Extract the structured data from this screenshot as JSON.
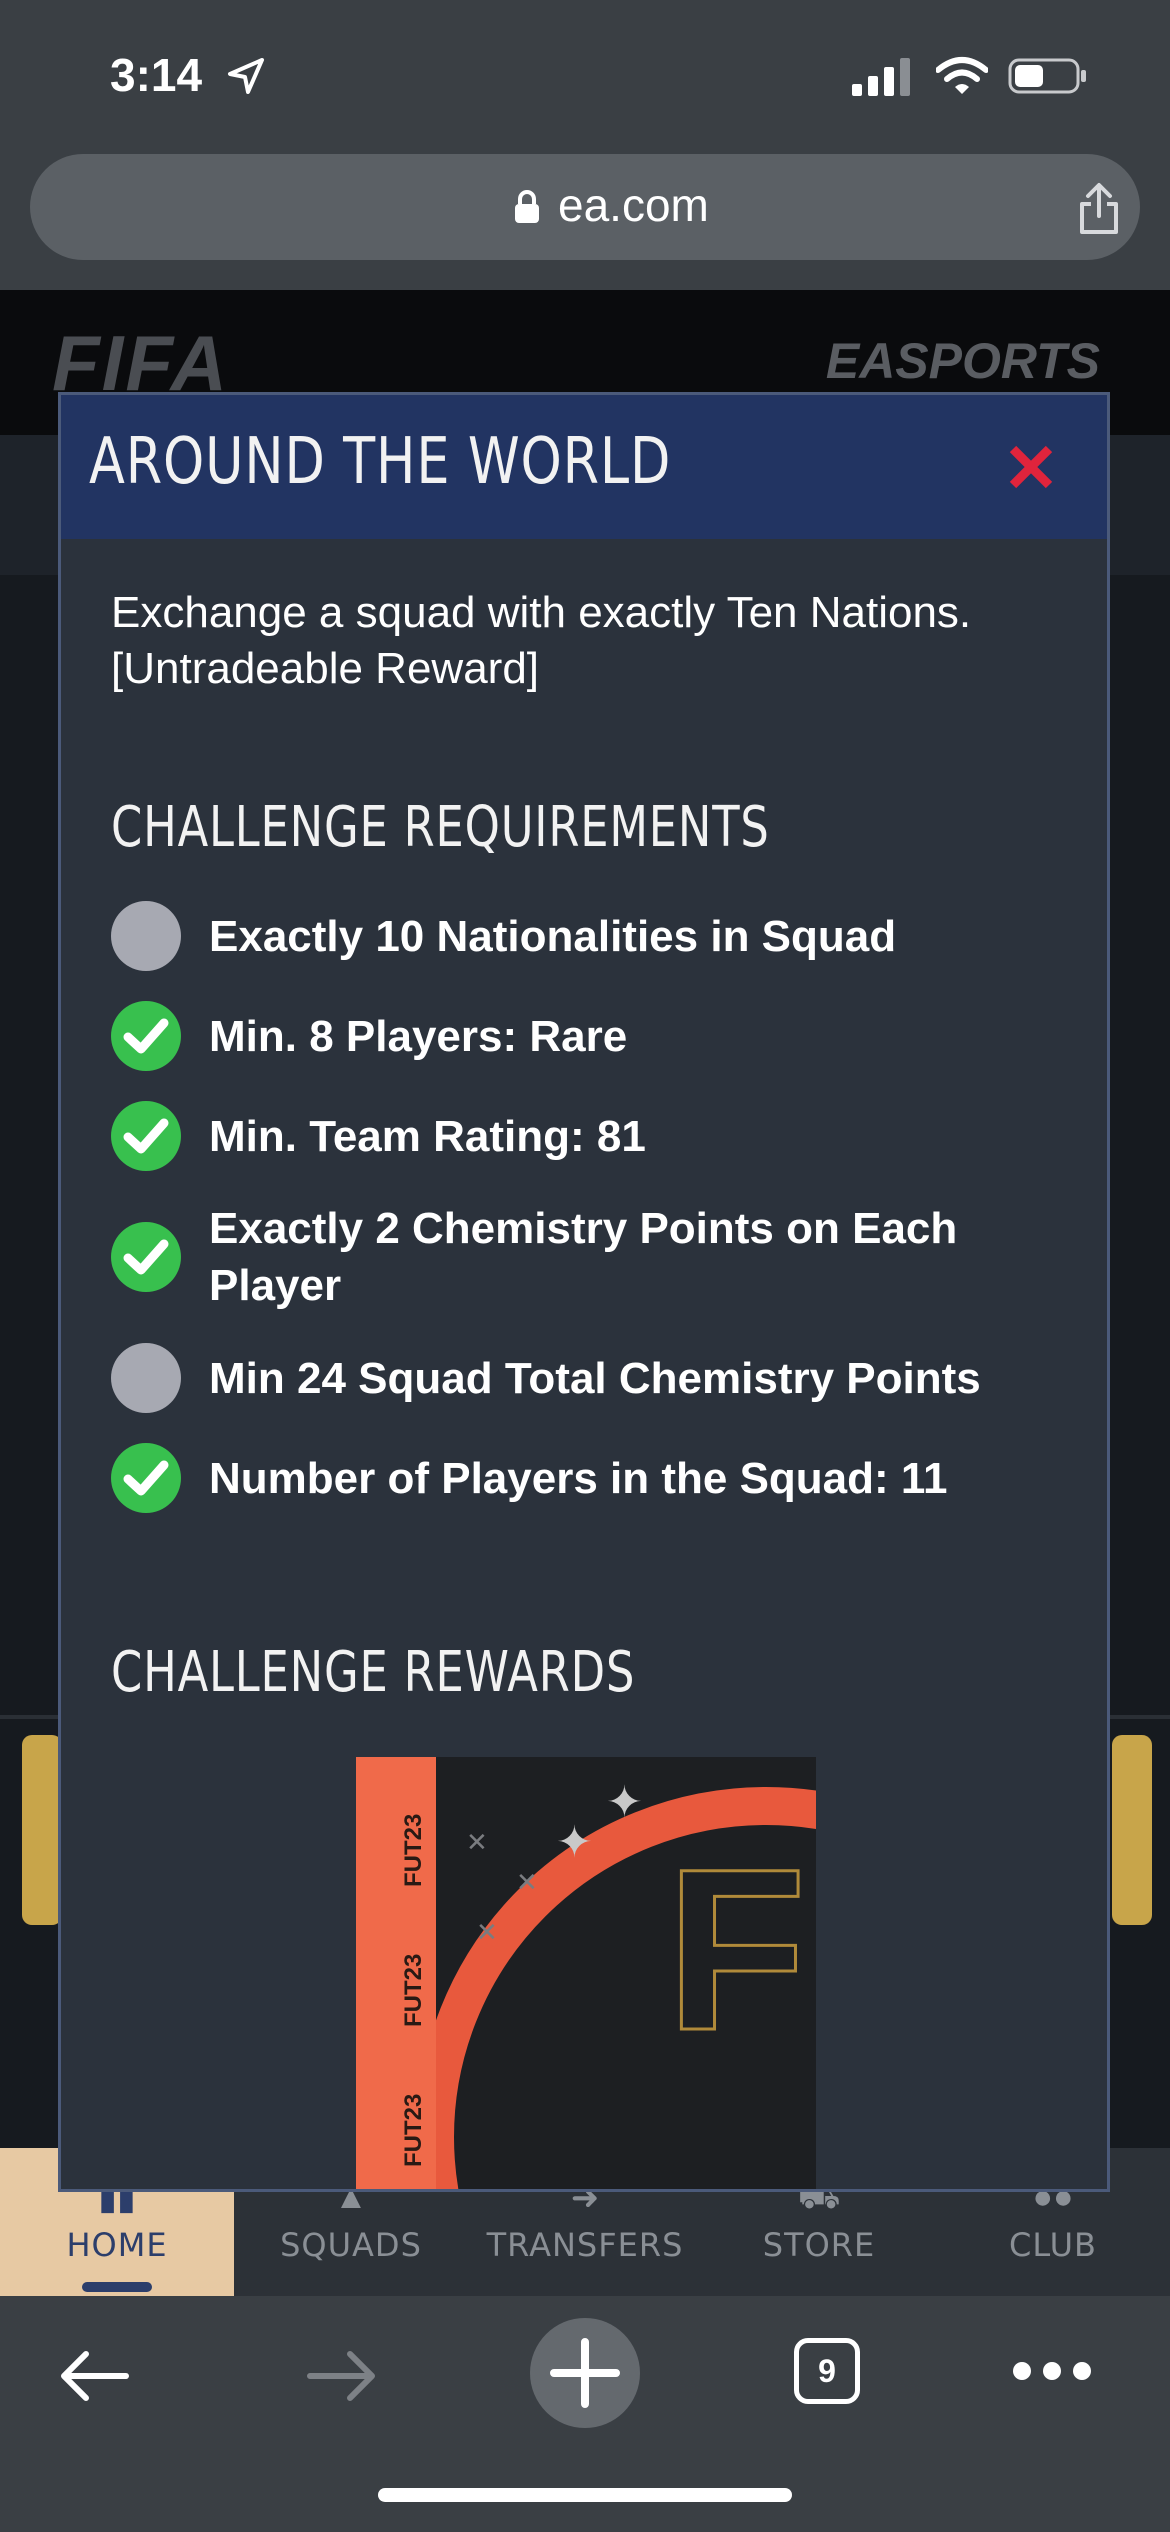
{
  "status_bar": {
    "time": "3:14",
    "icons": [
      "location-arrow-icon",
      "cellular-signal-icon",
      "wifi-icon",
      "battery-icon"
    ]
  },
  "browser": {
    "url": "ea.com",
    "tab_count": "9"
  },
  "app": {
    "logo": "FIFA",
    "brand": "EASPORTS",
    "tabs": [
      {
        "label": "HOME",
        "active": true
      },
      {
        "label": "SQUADS",
        "active": false
      },
      {
        "label": "TRANSFERS",
        "active": false
      },
      {
        "label": "STORE",
        "active": false
      },
      {
        "label": "CLUB",
        "active": false
      }
    ]
  },
  "modal": {
    "title": "AROUND THE WORLD",
    "description": "Exchange a squad with exactly Ten Nations. [Untradeable Reward]",
    "requirements_title": "CHALLENGE REQUIREMENTS",
    "requirements": [
      {
        "text": "Exactly 10 Nationalities in Squad",
        "met": false
      },
      {
        "text": "Min. 8 Players: Rare",
        "met": true
      },
      {
        "text": "Min. Team Rating: 81",
        "met": true
      },
      {
        "text": "Exactly 2 Chemistry Points on Each Player",
        "met": true
      },
      {
        "text": "Min 24 Squad Total Chemistry Points",
        "met": false
      },
      {
        "text": "Number of Players in the Squad: 11",
        "met": true
      }
    ],
    "rewards_title": "CHALLENGE REWARDS",
    "reward_pack_label": "FUT23"
  },
  "colors": {
    "modal_header": "#223462",
    "modal_body": "#2b323c",
    "check_green": "#38c04e",
    "pending_gray": "#a7a9b2",
    "close_red": "#e0243c",
    "active_tab": "#e7c9a3"
  }
}
